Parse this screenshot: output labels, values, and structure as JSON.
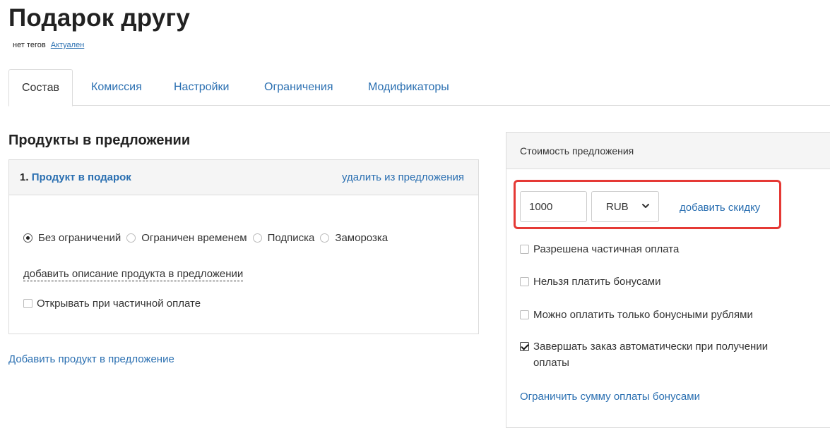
{
  "header": {
    "title": "Подарок другу",
    "tags": "нет тегов",
    "status": "Актуален"
  },
  "tabs": [
    {
      "label": "Состав",
      "active": true
    },
    {
      "label": "Комиссия"
    },
    {
      "label": "Настройки"
    },
    {
      "label": "Ограничения"
    },
    {
      "label": "Модификаторы"
    }
  ],
  "products": {
    "section_title": "Продукты в предложении",
    "item": {
      "number": "1.",
      "name": "Продукт в подарок",
      "remove_label": "удалить из предложения",
      "access_options": [
        {
          "label": "Без ограничений",
          "checked": true
        },
        {
          "label": "Ограничен временем",
          "checked": false
        },
        {
          "label": "Подписка",
          "checked": false
        },
        {
          "label": "Заморозка",
          "checked": false
        }
      ],
      "add_description_label": "добавить описание продукта в предложении",
      "open_partial_label": "Открывать при частичной оплате",
      "open_partial_checked": false
    },
    "add_product_label": "Добавить продукт в предложение"
  },
  "price": {
    "header": "Стоимость предложения",
    "amount": "1000",
    "currency": "RUB",
    "add_discount_label": "добавить скидку",
    "options": [
      {
        "label": "Разрешена частичная оплата",
        "checked": false
      },
      {
        "label": "Нельзя платить бонусами",
        "checked": false
      },
      {
        "label": "Можно оплатить только бонусными рублями",
        "checked": false
      },
      {
        "label": "Завершать заказ автоматически при получении оплаты",
        "checked": true
      }
    ],
    "limit_bonus_label": "Ограничить сумму оплаты бонусами"
  },
  "colors": {
    "link": "#2a6fb1",
    "highlight": "#e53935"
  }
}
